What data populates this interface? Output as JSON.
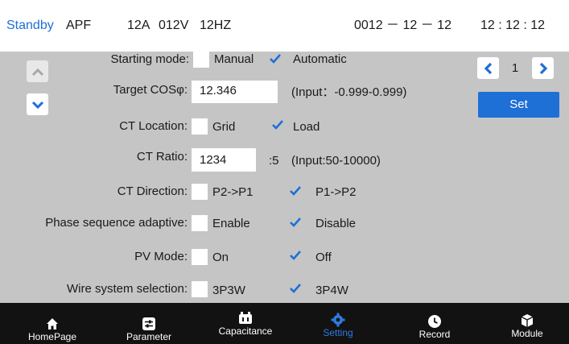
{
  "status": {
    "state": "Standby",
    "device": "APF",
    "current": "12A",
    "voltage": "012V",
    "frequency": "12HZ",
    "date": "0012 － 12 － 12",
    "time": "12 : 12 : 12"
  },
  "settings": {
    "starting_mode": {
      "label": "Starting mode:",
      "opt1": "Manual",
      "opt2": "Automatic",
      "selected": "Automatic"
    },
    "target_cos": {
      "label": "Target COSφ:",
      "value": "12.346",
      "hint": "(Input：-0.999-0.999)"
    },
    "ct_location": {
      "label": "CT Location:",
      "opt1": "Grid",
      "opt2": "Load",
      "selected": "Load"
    },
    "ct_ratio": {
      "label": "CT Ratio:",
      "value": "1234",
      "suffix": ":5",
      "hint": "(Input:50-10000)"
    },
    "ct_direction": {
      "label": "CT Direction:",
      "opt1": "P2->P1",
      "opt2": "P1->P2",
      "selected": "P1->P2"
    },
    "phase_seq": {
      "label": "Phase sequence adaptive:",
      "opt1": "Enable",
      "opt2": "Disable",
      "selected": "Disable"
    },
    "pv_mode": {
      "label": "PV Mode:",
      "opt1": "On",
      "opt2": "Off",
      "selected": "Off"
    },
    "wire_system": {
      "label": "Wire system selection:",
      "opt1": "3P3W",
      "opt2": "3P4W",
      "selected": "3P4W"
    }
  },
  "pager": {
    "page": "1",
    "set_label": "Set"
  },
  "nav": {
    "tabs": [
      {
        "label": "HomePage",
        "icon": "home-icon"
      },
      {
        "label": "Parameter",
        "icon": "sliders-icon"
      },
      {
        "label": "Capacitance",
        "icon": "capacitor-icon"
      },
      {
        "label": "Setting",
        "icon": "gear-icon"
      },
      {
        "label": "Record",
        "icon": "clock-icon"
      },
      {
        "label": "Module",
        "icon": "cube-icon"
      }
    ],
    "active": "Setting"
  },
  "colors": {
    "accent": "#1e6fd6",
    "panel": "#c5c5c5",
    "navbar": "#121212",
    "active_tab": "#2f7be0"
  }
}
